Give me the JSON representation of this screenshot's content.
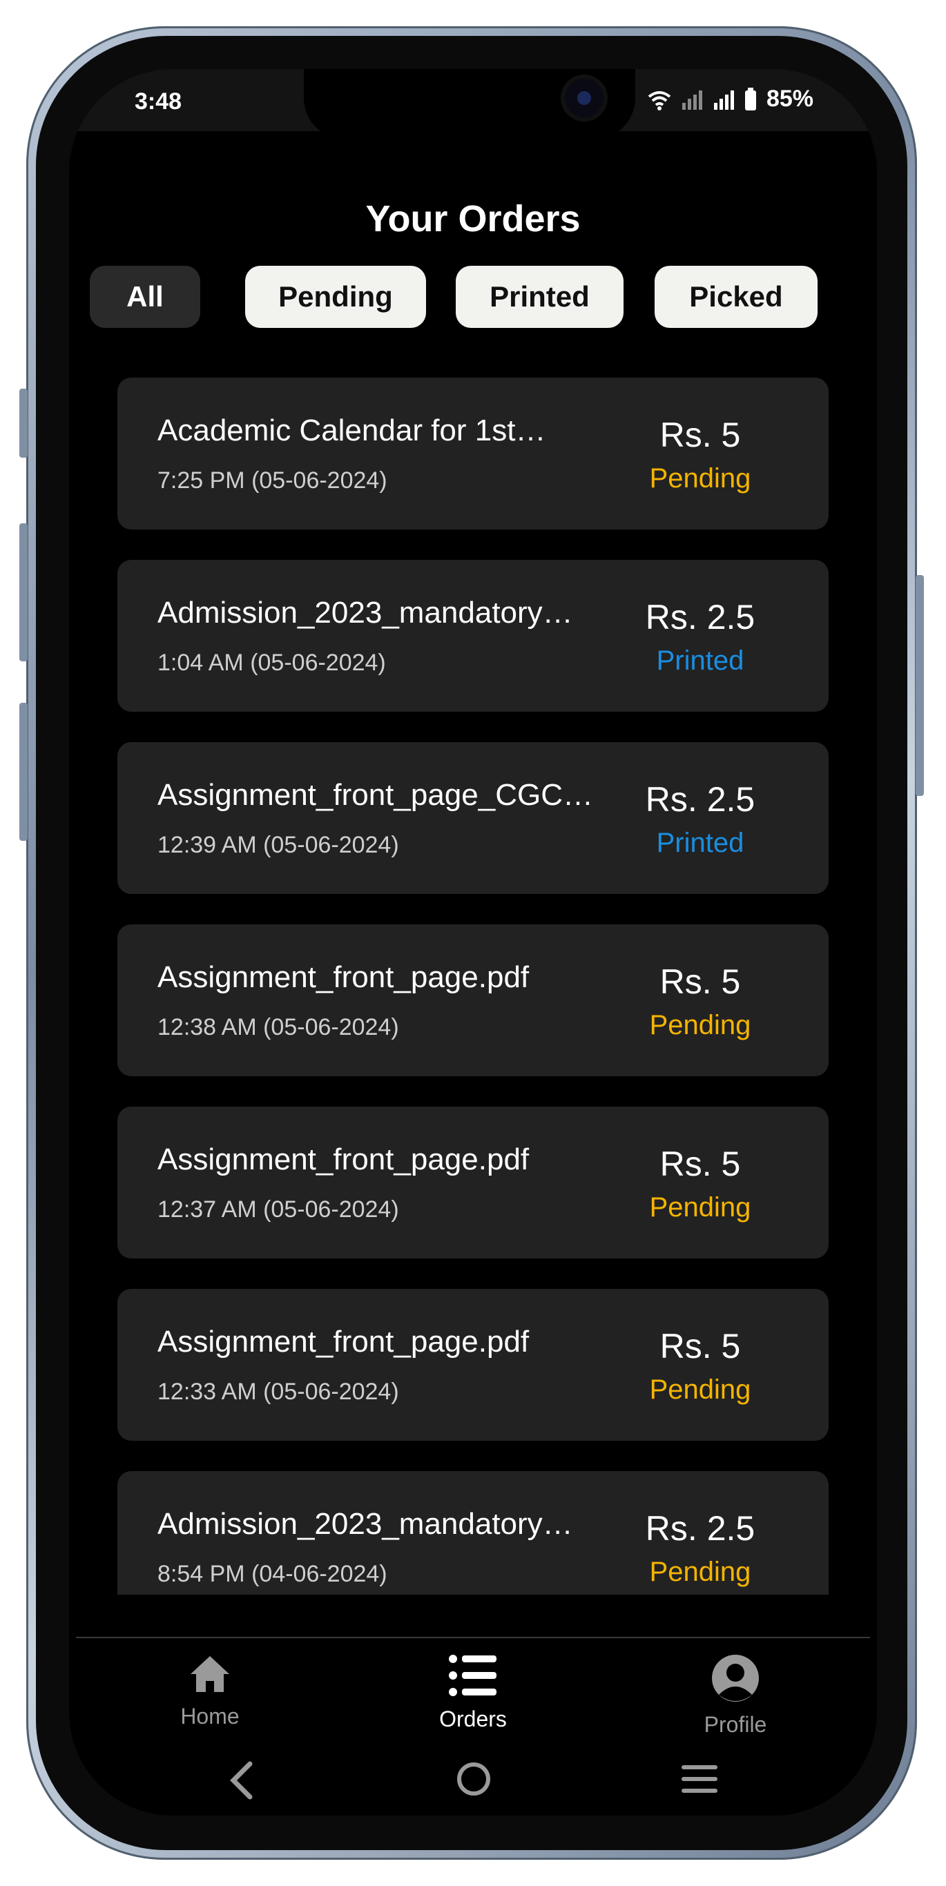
{
  "status_bar": {
    "time": "3:48",
    "battery": "85%"
  },
  "header": {
    "title": "Your Orders"
  },
  "filters": [
    {
      "label": "All",
      "active": true
    },
    {
      "label": "Pending",
      "active": false
    },
    {
      "label": "Printed",
      "active": false
    },
    {
      "label": "Picked",
      "active": false
    }
  ],
  "orders": [
    {
      "title": "Academic Calendar for 1st…",
      "time": "7:25 PM (05-06-2024)",
      "price": "Rs. 5",
      "status": "Pending"
    },
    {
      "title": "Admission_2023_mandatory…",
      "time": "1:04 AM (05-06-2024)",
      "price": "Rs. 2.5",
      "status": "Printed"
    },
    {
      "title": "Assignment_front_page_CGC…",
      "time": "12:39 AM (05-06-2024)",
      "price": "Rs. 2.5",
      "status": "Printed"
    },
    {
      "title": "Assignment_front_page.pdf",
      "time": "12:38 AM (05-06-2024)",
      "price": "Rs. 5",
      "status": "Pending"
    },
    {
      "title": "Assignment_front_page.pdf",
      "time": "12:37 AM (05-06-2024)",
      "price": "Rs. 5",
      "status": "Pending"
    },
    {
      "title": "Assignment_front_page.pdf",
      "time": "12:33 AM (05-06-2024)",
      "price": "Rs. 5",
      "status": "Pending"
    },
    {
      "title": "Admission_2023_mandatory…",
      "time": "8:54 PM (04-06-2024)",
      "price": "Rs. 2.5",
      "status": "Pending"
    }
  ],
  "status_colors": {
    "Pending": "#f5b400",
    "Printed": "#1a8ee0"
  },
  "bottom_nav": {
    "items": [
      {
        "label": "Home",
        "icon": "home-icon",
        "active": false
      },
      {
        "label": "Orders",
        "icon": "list-icon",
        "active": true
      },
      {
        "label": "Profile",
        "icon": "profile-icon",
        "active": false
      }
    ]
  },
  "colors": {
    "background": "#000000",
    "card": "#222222",
    "active_tab": "#2a2a2a",
    "inactive_tab": "#f2f2ef",
    "nav_inactive": "#9a9a9a",
    "nav_active": "#ffffff"
  }
}
